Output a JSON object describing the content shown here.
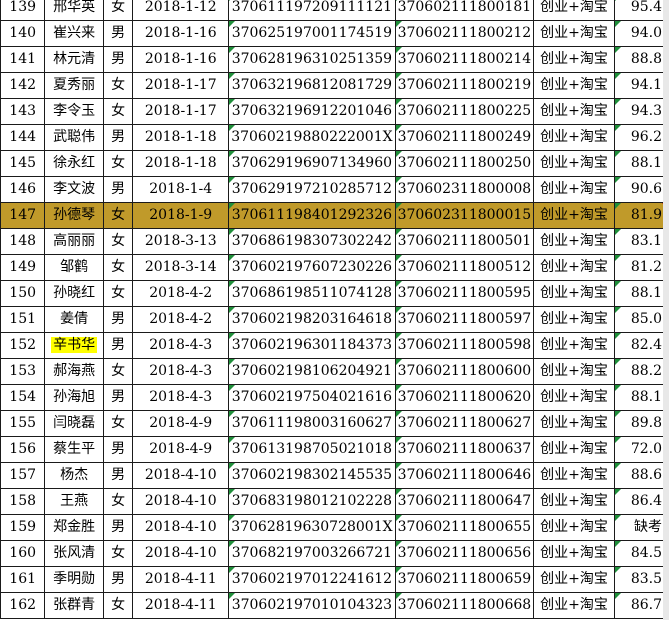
{
  "rows": [
    {
      "id": "139",
      "name": "邢华英",
      "gender": "女",
      "date": "2018-1-12",
      "idcard": "370611197209111121",
      "account": "370602111800181",
      "program": "创业+淘宝",
      "score": "95.4"
    },
    {
      "id": "140",
      "name": "崔兴来",
      "gender": "男",
      "date": "2018-1-16",
      "idcard": "370625197001174519",
      "account": "370602111800212",
      "program": "创业+淘宝",
      "score": "94.0"
    },
    {
      "id": "141",
      "name": "林元清",
      "gender": "男",
      "date": "2018-1-16",
      "idcard": "370628196310251359",
      "account": "370602111800214",
      "program": "创业+淘宝",
      "score": "88.8"
    },
    {
      "id": "142",
      "name": "夏秀丽",
      "gender": "女",
      "date": "2018-1-17",
      "idcard": "370632196812081729",
      "account": "370602111800219",
      "program": "创业+淘宝",
      "score": "94.1"
    },
    {
      "id": "143",
      "name": "李令玉",
      "gender": "女",
      "date": "2018-1-17",
      "idcard": "370632196912201046",
      "account": "370602111800225",
      "program": "创业+淘宝",
      "score": "94.3"
    },
    {
      "id": "144",
      "name": "武聪伟",
      "gender": "男",
      "date": "2018-1-18",
      "idcard": "37060219880222001X",
      "account": "370602111800249",
      "program": "创业+淘宝",
      "score": "96.2"
    },
    {
      "id": "145",
      "name": "徐永红",
      "gender": "女",
      "date": "2018-1-18",
      "idcard": "370629196907134960",
      "account": "370602111800250",
      "program": "创业+淘宝",
      "score": "88.1"
    },
    {
      "id": "146",
      "name": "李文波",
      "gender": "男",
      "date": "2018-1-4",
      "idcard": "370629197210285712",
      "account": "370602311800008",
      "program": "创业+淘宝",
      "score": "90.6"
    },
    {
      "id": "147",
      "name": "孙德琴",
      "gender": "女",
      "date": "2018-1-9",
      "idcard": "370611198401292326",
      "account": "370602311800015",
      "program": "创业+淘宝",
      "score": "81.9"
    },
    {
      "id": "148",
      "name": "高丽丽",
      "gender": "女",
      "date": "2018-3-13",
      "idcard": "370686198307302242",
      "account": "370602111800501",
      "program": "创业+淘宝",
      "score": "83.1"
    },
    {
      "id": "149",
      "name": "邹鹤",
      "gender": "女",
      "date": "2018-3-14",
      "idcard": "370602197607230226",
      "account": "370602111800512",
      "program": "创业+淘宝",
      "score": "81.2"
    },
    {
      "id": "150",
      "name": "孙晓红",
      "gender": "女",
      "date": "2018-4-2",
      "idcard": "370686198511074128",
      "account": "370602111800595",
      "program": "创业+淘宝",
      "score": "88.1"
    },
    {
      "id": "151",
      "name": "姜倩",
      "gender": "男",
      "date": "2018-4-2",
      "idcard": "370602198203164618",
      "account": "370602111800597",
      "program": "创业+淘宝",
      "score": "85.0"
    },
    {
      "id": "152",
      "name": "辛书华",
      "gender": "男",
      "date": "2018-4-3",
      "idcard": "370602196301184373",
      "account": "370602111800598",
      "program": "创业+淘宝",
      "score": "82.4"
    },
    {
      "id": "153",
      "name": "郝海燕",
      "gender": "女",
      "date": "2018-4-3",
      "idcard": "370602198106204921",
      "account": "370602111800600",
      "program": "创业+淘宝",
      "score": "88.2"
    },
    {
      "id": "154",
      "name": "孙海旭",
      "gender": "男",
      "date": "2018-4-3",
      "idcard": "370602197504021616",
      "account": "370602111800620",
      "program": "创业+淘宝",
      "score": "88.1"
    },
    {
      "id": "155",
      "name": "闫晓磊",
      "gender": "女",
      "date": "2018-4-9",
      "idcard": "370611198003160627",
      "account": "370602111800627",
      "program": "创业+淘宝",
      "score": "89.8"
    },
    {
      "id": "156",
      "name": "蔡生平",
      "gender": "男",
      "date": "2018-4-9",
      "idcard": "370613198705021018",
      "account": "370602111800637",
      "program": "创业+淘宝",
      "score": "72.0"
    },
    {
      "id": "157",
      "name": "杨杰",
      "gender": "男",
      "date": "2018-4-10",
      "idcard": "370602198302145535",
      "account": "370602111800646",
      "program": "创业+淘宝",
      "score": "88.6"
    },
    {
      "id": "158",
      "name": "王燕",
      "gender": "女",
      "date": "2018-4-10",
      "idcard": "370683198012102228",
      "account": "370602111800647",
      "program": "创业+淘宝",
      "score": "86.4"
    },
    {
      "id": "159",
      "name": "郑金胜",
      "gender": "男",
      "date": "2018-4-10",
      "idcard": "37062819630728001X",
      "account": "370602111800655",
      "program": "创业+淘宝",
      "score": "缺考"
    },
    {
      "id": "160",
      "name": "张风清",
      "gender": "女",
      "date": "2018-4-10",
      "idcard": "370682197003266721",
      "account": "370602111800656",
      "program": "创业+淘宝",
      "score": "84.5"
    },
    {
      "id": "161",
      "name": "季明勋",
      "gender": "男",
      "date": "2018-4-11",
      "idcard": "370602197012241612",
      "account": "370602111800659",
      "program": "创业+淘宝",
      "score": "83.5"
    },
    {
      "id": "162",
      "name": "张群青",
      "gender": "女",
      "date": "2018-4-11",
      "idcard": "370602197010104323",
      "account": "370602111800668",
      "program": "创业+淘宝",
      "score": "86.7"
    }
  ],
  "highlighted_row_id": "147",
  "yellow_name_row_id": "152",
  "colors": {
    "row_highlight": "#c09a2a",
    "name_highlight": "#ffff00",
    "grid": "#1a1a1a",
    "comment_marker": "#d00000",
    "indicator_marker": "#1f8f3a"
  }
}
